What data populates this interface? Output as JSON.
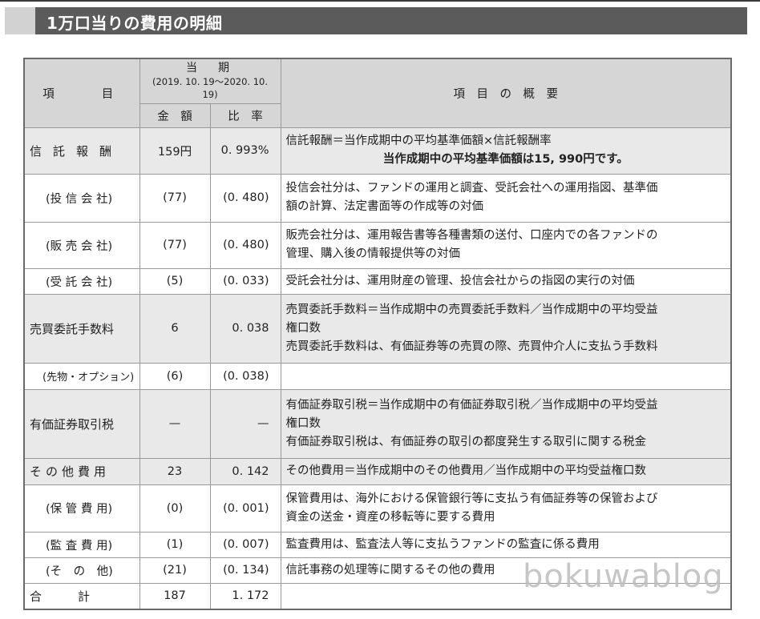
{
  "header": {
    "title": "1万口当りの費用の明細"
  },
  "table": {
    "head": {
      "item": "項　　目",
      "period_label": "当　期",
      "period_dates": "(2019. 10. 19～2020. 10. 19)",
      "amount": "金　額",
      "rate": "比　率",
      "summary": "項　目　の　概　要"
    },
    "rows": [
      {
        "item": "信託報酬",
        "amount": "159円",
        "rate": "0. 993%",
        "desc1": "信託報酬＝当作成期中の平均基準価額×信託報酬率",
        "desc2": "当作成期中の平均基準価額は15, 990円です。"
      },
      {
        "item": "(投 信 会 社)",
        "amount": "(77)",
        "rate": "(0. 480)",
        "desc1": "投信会社分は、ファンドの運用と調査、受託会社への運用指図、基準価",
        "desc2": "額の計算、法定書面等の作成等の対価"
      },
      {
        "item": "(販 売 会 社)",
        "amount": "(77)",
        "rate": "(0. 480)",
        "desc1": "販売会社分は、運用報告書等各種書類の送付、口座内での各ファンドの",
        "desc2": "管理、購入後の情報提供等の対価"
      },
      {
        "item": "(受 託 会 社)",
        "amount": "(5)",
        "rate": "(0. 033)",
        "desc1": "受託会社分は、運用財産の管理、投信会社からの指図の実行の対価"
      },
      {
        "item": "売買委託手数料",
        "amount": "6",
        "rate": "0. 038",
        "desc1": "売買委託手数料＝当作成期中の売買委託手数料／当作成期中の平均受益",
        "desc2": "権口数",
        "desc3": "売買委託手数料は、有価証券等の売買の際、売買仲介人に支払う手数料"
      },
      {
        "item": "(先物・オプション)",
        "amount": "(6)",
        "rate": "(0. 038)",
        "desc1": ""
      },
      {
        "item": "有価証券取引税",
        "amount": "—",
        "rate": "—",
        "desc1": "有価証券取引税＝当作成期中の有価証券取引税／当作成期中の平均受益",
        "desc2": "権口数",
        "desc3": "有価証券取引税は、有価証券の取引の都度発生する取引に関する税金"
      },
      {
        "item": "その他費用",
        "amount": "23",
        "rate": "0. 142",
        "desc1": "その他費用＝当作成期中のその他費用／当作成期中の平均受益権口数"
      },
      {
        "item": "(保 管 費 用)",
        "amount": "(0)",
        "rate": "(0. 001)",
        "desc1": "保管費用は、海外における保管銀行等に支払う有価証券等の保管および",
        "desc2": "資金の送金・資産の移転等に要する費用"
      },
      {
        "item": "(監 査 費 用)",
        "amount": "(1)",
        "rate": "(0. 007)",
        "desc1": "監査費用は、監査法人等に支払うファンドの監査に係る費用"
      },
      {
        "item": "(そ　の　他)",
        "amount": "(21)",
        "rate": "(0. 134)",
        "desc1": "信託事務の処理等に関するその他の費用"
      }
    ],
    "total": {
      "item": "合　　　計",
      "amount": "187",
      "rate": "1. 172"
    }
  },
  "watermark": "bokuwablog"
}
